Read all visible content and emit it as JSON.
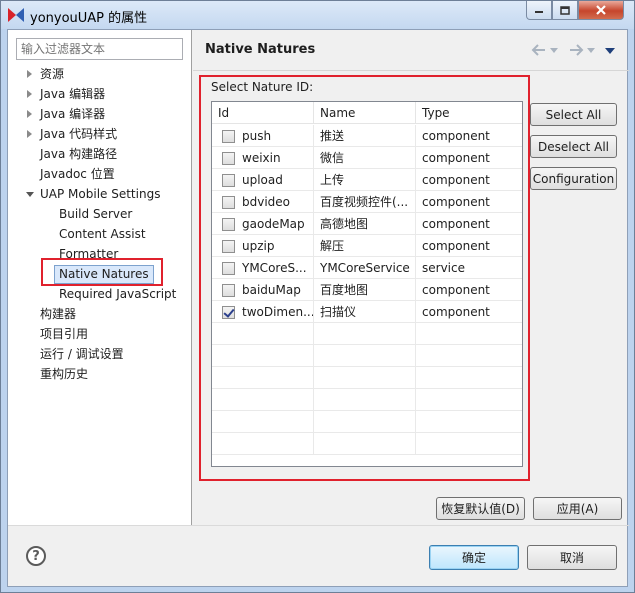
{
  "window": {
    "title": "yonyouUAP 的属性"
  },
  "filter": {
    "placeholder": "输入过滤器文本"
  },
  "tree": [
    {
      "label": "资源",
      "indent": 0,
      "arrow": "right"
    },
    {
      "label": "Java 编辑器",
      "indent": 0,
      "arrow": "right"
    },
    {
      "label": "Java 编译器",
      "indent": 0,
      "arrow": "right"
    },
    {
      "label": "Java 代码样式",
      "indent": 0,
      "arrow": "right"
    },
    {
      "label": "Java 构建路径",
      "indent": 0,
      "arrow": ""
    },
    {
      "label": "Javadoc 位置",
      "indent": 0,
      "arrow": ""
    },
    {
      "label": "UAP Mobile Settings",
      "indent": 0,
      "arrow": "down"
    },
    {
      "label": "Build Server",
      "indent": 1,
      "arrow": ""
    },
    {
      "label": "Content Assist",
      "indent": 1,
      "arrow": ""
    },
    {
      "label": "Formatter",
      "indent": 1,
      "arrow": ""
    },
    {
      "label": "Native Natures",
      "indent": 1,
      "arrow": "",
      "selected": true
    },
    {
      "label": "Required JavaScript",
      "indent": 1,
      "arrow": ""
    },
    {
      "label": "构建器",
      "indent": 0,
      "arrow": ""
    },
    {
      "label": "项目引用",
      "indent": 0,
      "arrow": ""
    },
    {
      "label": "运行 / 调试设置",
      "indent": 0,
      "arrow": ""
    },
    {
      "label": "重构历史",
      "indent": 0,
      "arrow": ""
    }
  ],
  "page": {
    "title": "Native Natures",
    "group_label": "Select Nature ID:"
  },
  "table": {
    "headers": [
      "Id",
      "Name",
      "Type"
    ],
    "rows": [
      {
        "checked": false,
        "id": "push",
        "name": "推送",
        "type": "component"
      },
      {
        "checked": false,
        "id": "weixin",
        "name": "微信",
        "type": "component"
      },
      {
        "checked": false,
        "id": "upload",
        "name": "上传",
        "type": "component"
      },
      {
        "checked": false,
        "id": "bdvideo",
        "name": "百度视频控件(...",
        "type": "component"
      },
      {
        "checked": false,
        "id": "gaodeMap",
        "name": "高德地图",
        "type": "component"
      },
      {
        "checked": false,
        "id": "upzip",
        "name": "解压",
        "type": "component"
      },
      {
        "checked": false,
        "id": "YMCoreS...",
        "name": "YMCoreService",
        "type": "service"
      },
      {
        "checked": false,
        "id": "baiduMap",
        "name": "百度地图",
        "type": "component"
      },
      {
        "checked": true,
        "id": "twoDimen...",
        "name": "扫描仪",
        "type": "component"
      }
    ]
  },
  "buttons": {
    "select_all": "Select All",
    "deselect_all": "Deselect All",
    "configuration": "Configuration",
    "restore_defaults": "恢复默认值(D)",
    "apply": "应用(A)",
    "ok": "确定",
    "cancel": "取消"
  },
  "colors": {
    "highlight": "#e0212d",
    "selection": "#d9e8fb"
  }
}
